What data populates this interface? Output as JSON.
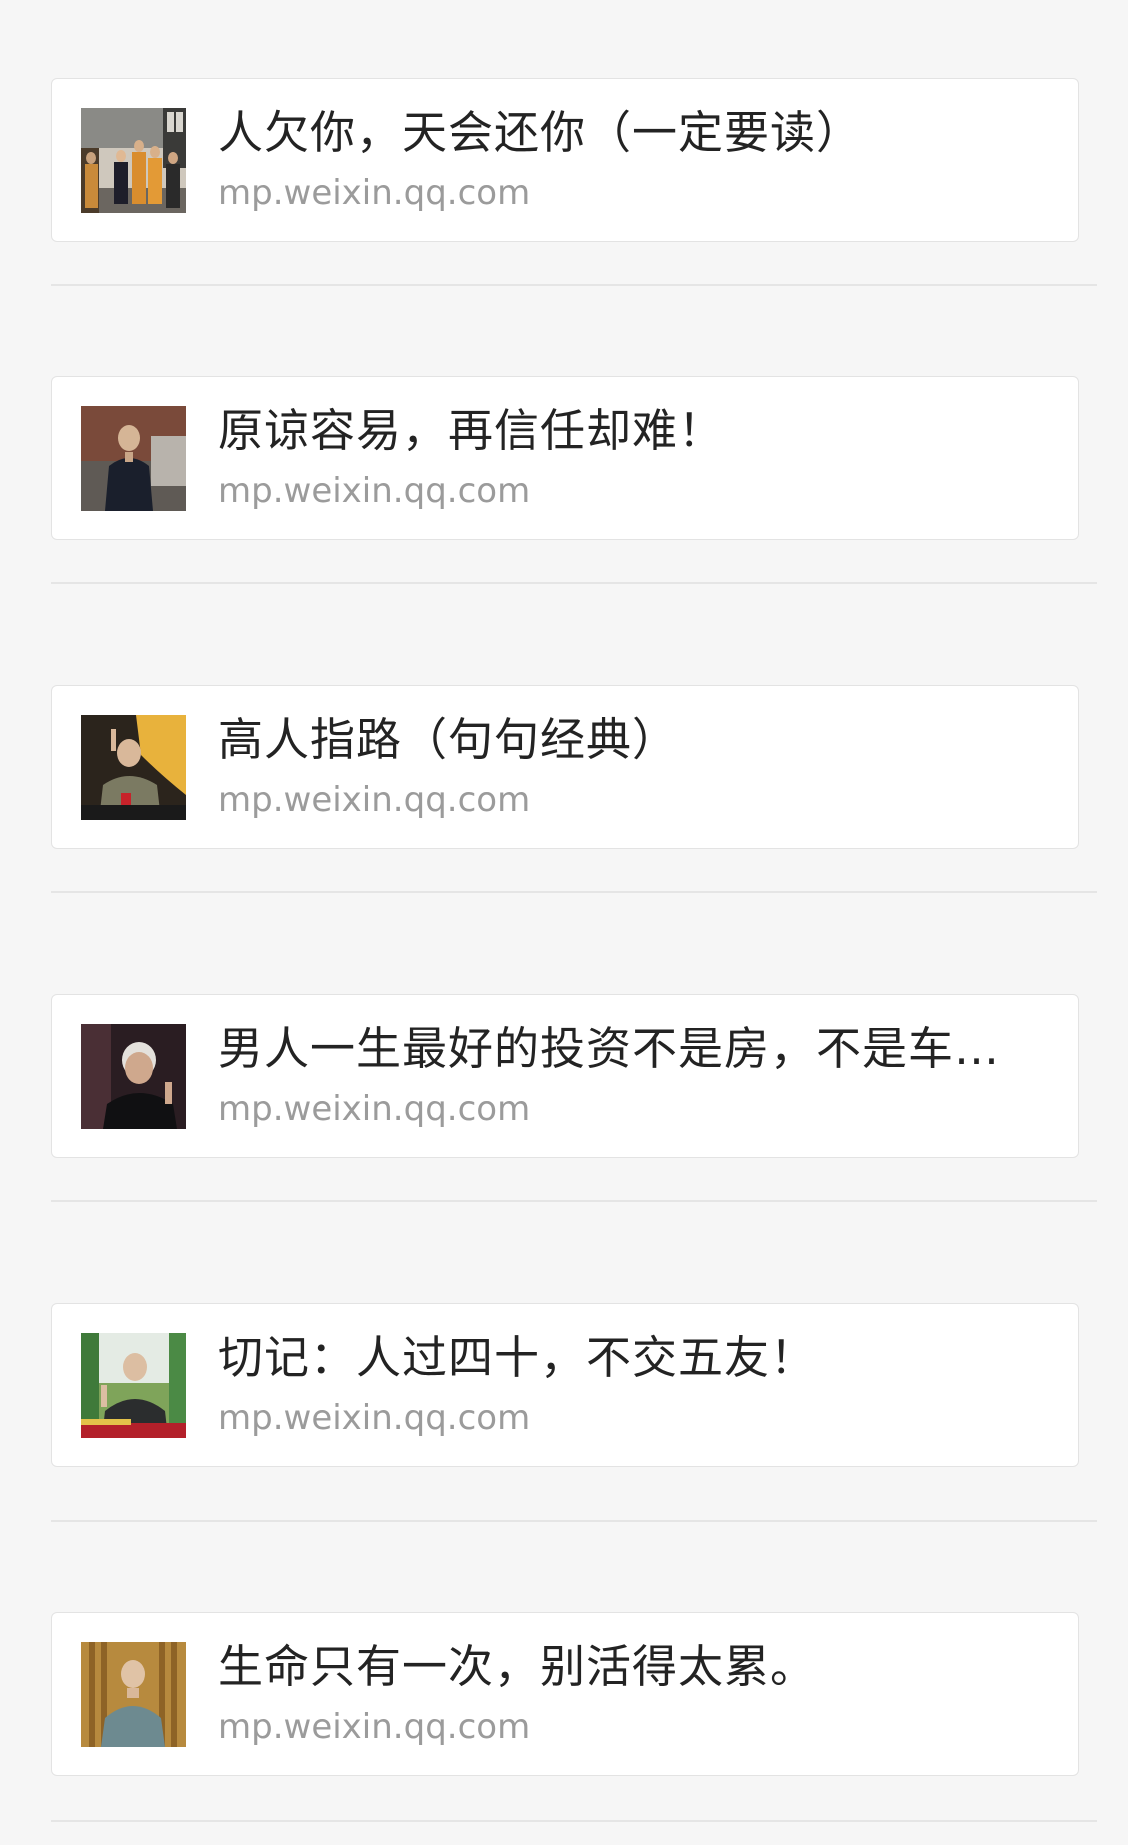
{
  "colors": {
    "page_background": "#f6f6f6",
    "card_background": "#ffffff",
    "title_text": "#232323",
    "source_text": "#9b9b9b",
    "divider": "#e5e5e5"
  },
  "articles": [
    {
      "title": "人欠你，天会还你（一定要读）",
      "source": "mp.weixin.qq.com",
      "thumbnail_icon": "group-photo-thumbnail"
    },
    {
      "title": "原谅容易，再信任却难！",
      "source": "mp.weixin.qq.com",
      "thumbnail_icon": "portrait-photo-thumbnail"
    },
    {
      "title": "高人指路（句句经典）",
      "source": "mp.weixin.qq.com",
      "thumbnail_icon": "speaker-photo-thumbnail"
    },
    {
      "title": "男人一生最好的投资不是房，不是车…",
      "source": "mp.weixin.qq.com",
      "thumbnail_icon": "elder-portrait-thumbnail"
    },
    {
      "title": "切记：人过四十，不交五友！",
      "source": "mp.weixin.qq.com",
      "thumbnail_icon": "lecture-photo-thumbnail"
    },
    {
      "title": "生命只有一次，别活得太累。",
      "source": "mp.weixin.qq.com",
      "thumbnail_icon": "elder-standing-thumbnail"
    }
  ]
}
